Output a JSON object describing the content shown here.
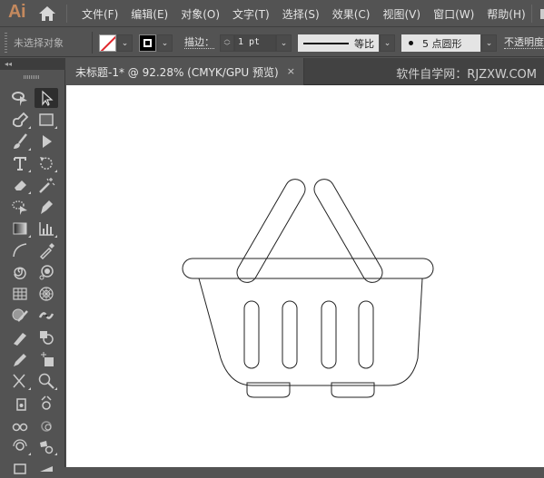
{
  "app": {
    "logo": "Ai",
    "menu": [
      "文件(F)",
      "编辑(E)",
      "对象(O)",
      "文字(T)",
      "选择(S)",
      "效果(C)",
      "视图(V)",
      "窗口(W)",
      "帮助(H)"
    ]
  },
  "control_bar": {
    "selection_status": "未选择对象",
    "fill": {
      "value": "none",
      "indicator_color": "#e0262b"
    },
    "stroke_swatch": "black",
    "stroke_label": "描边：",
    "stroke_weight": "1 pt",
    "line_profile": "等比",
    "brush": "5 点圆形",
    "opacity_label": "不透明度"
  },
  "tools_panel": {
    "collapse": "◂◂",
    "tools": [
      "lasso-select",
      "selection",
      "pen",
      "rectangle",
      "paintbrush",
      "direct-selection",
      "type",
      "rotate",
      "eraser",
      "magic-wand",
      "dotted-lasso",
      "pen-add",
      "gradient",
      "column-graph",
      "arc",
      "eyedropper",
      "spiral",
      "symbol-sprayer",
      "rectangular-grid",
      "polar-grid",
      "shaper",
      "puppet-warp",
      "pencil-blob",
      "shape-builder",
      "pencil",
      "artboard",
      "scissors",
      "zoom",
      "perspective",
      "symbol-shifter",
      "symbol-scruncher",
      "symbol-sizer",
      "symbol-spinner",
      "symbol-stainer",
      "slice",
      "width"
    ],
    "active_tool": "selection"
  },
  "document": {
    "tab_title": "未标题-1* @ 92.28% (CMYK/GPU 预览)",
    "close_glyph": "×",
    "watermark": "软件自学网：RJZXW.COM",
    "colors": {
      "canvas": "#ffffff",
      "stroke": "#222222"
    }
  }
}
